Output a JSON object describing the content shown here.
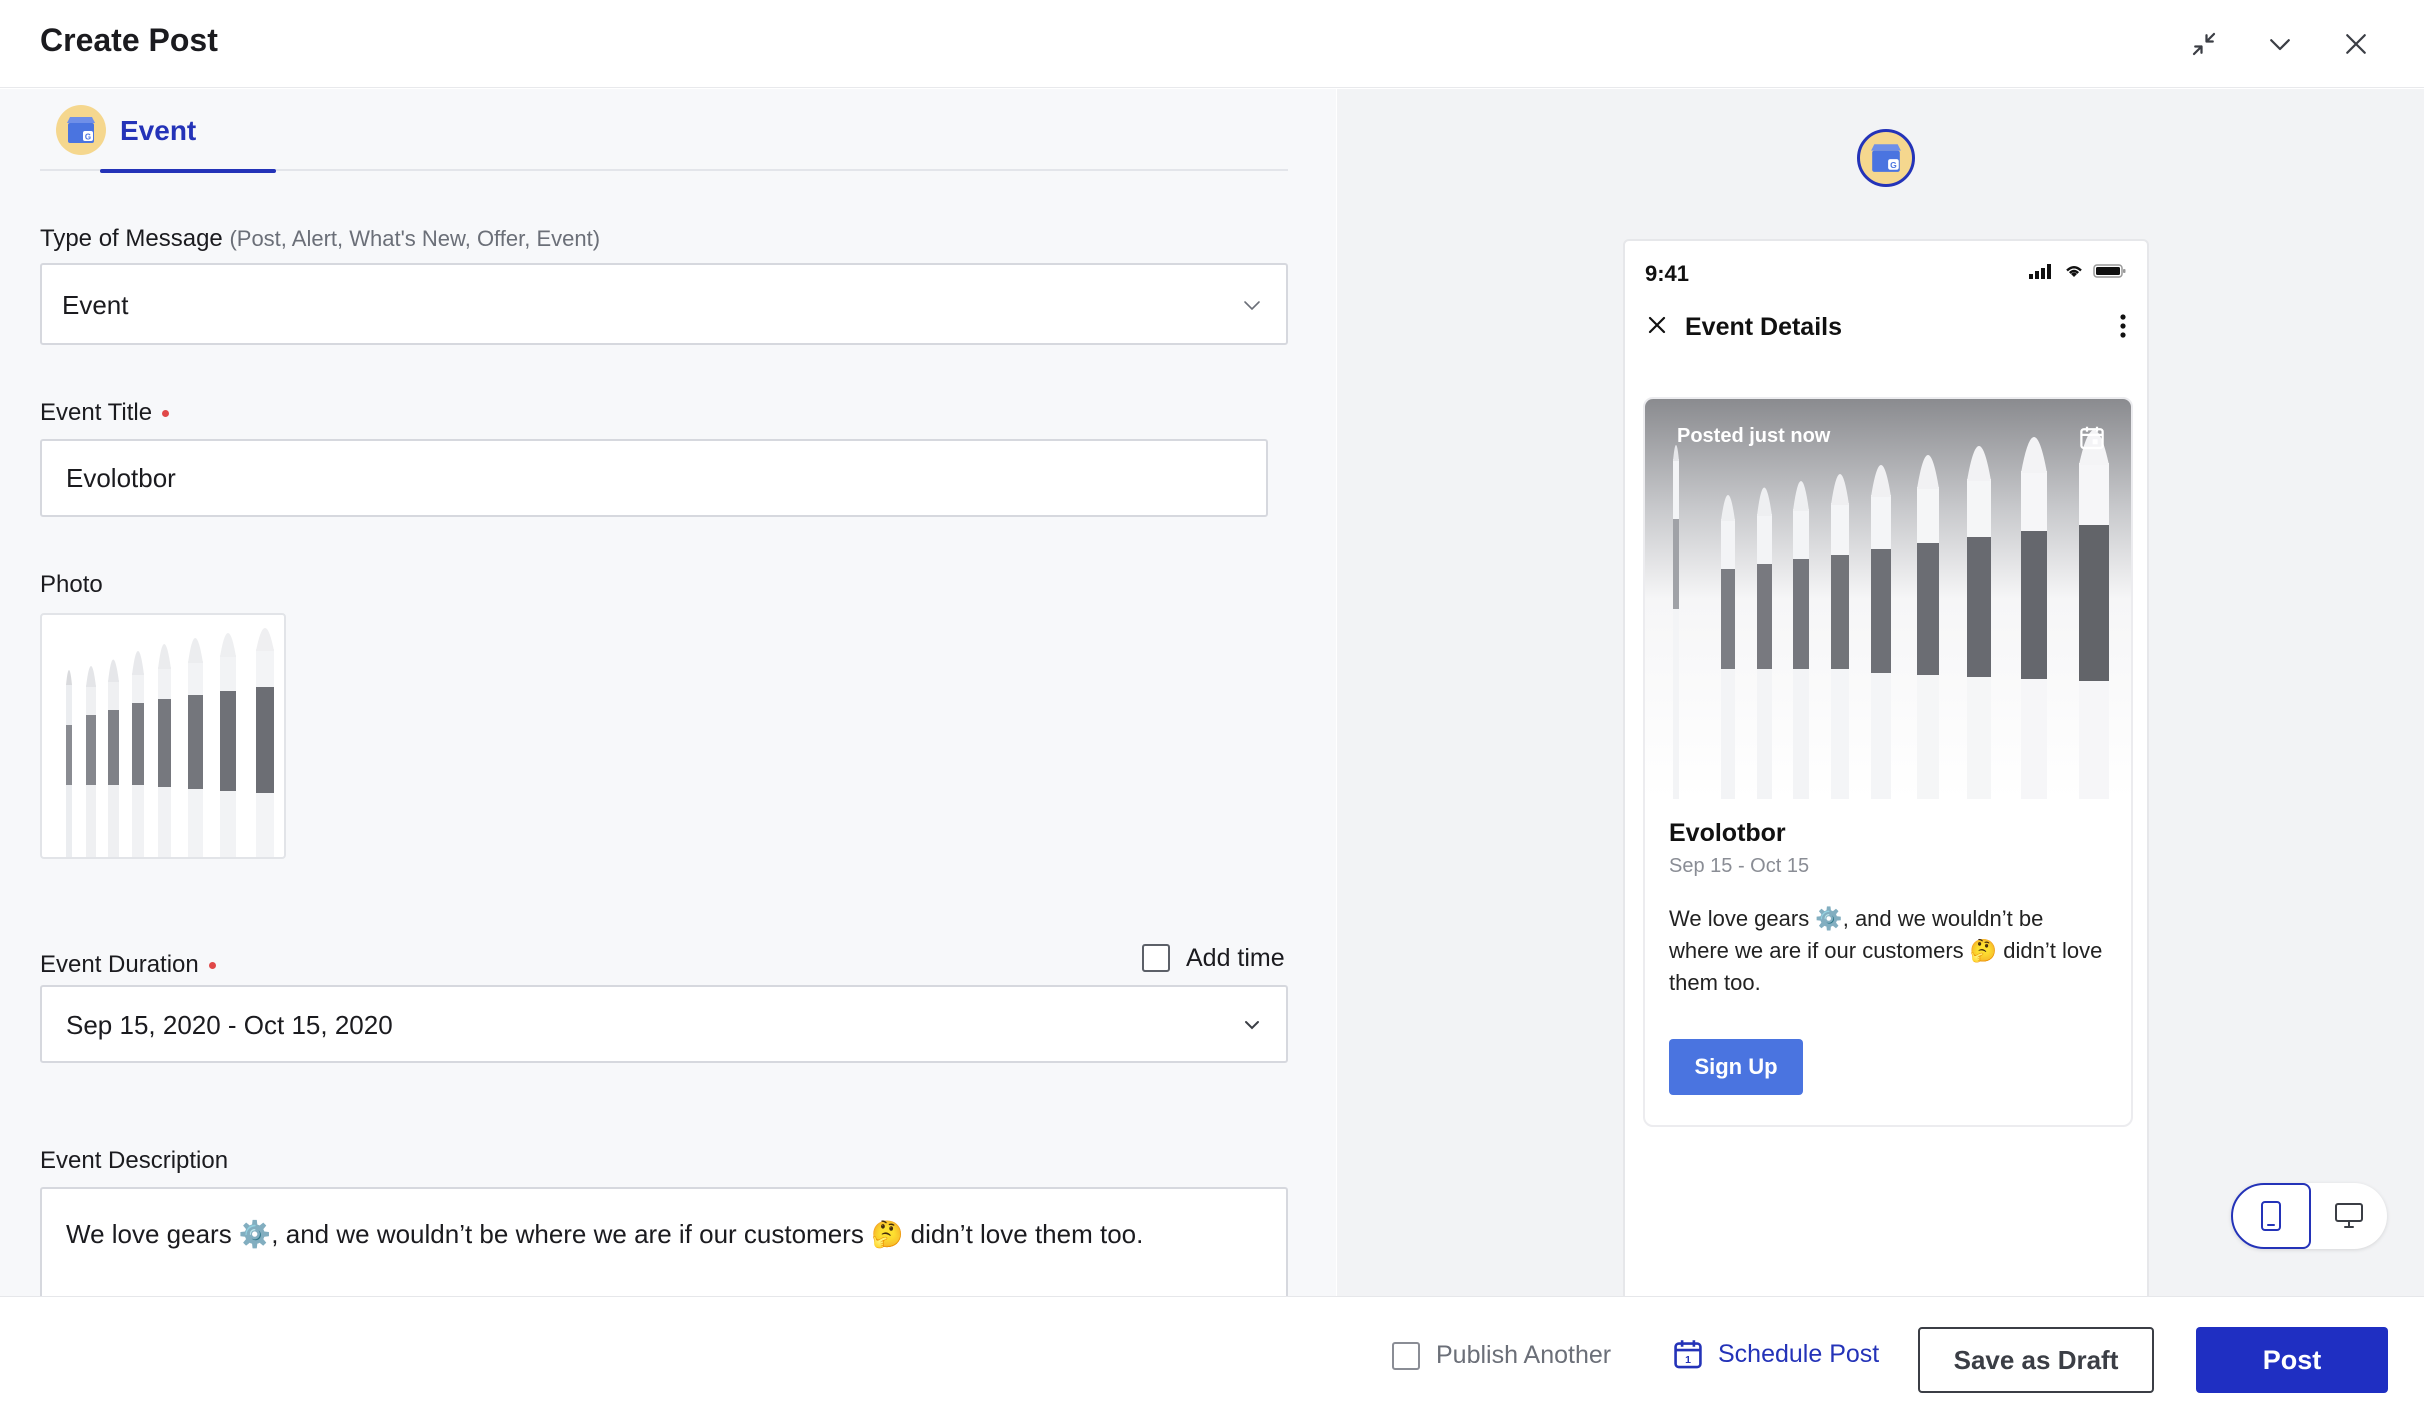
{
  "header": {
    "title": "Create Post",
    "actions": [
      "collapse-icon",
      "chevron-down-icon",
      "close-icon"
    ]
  },
  "tab": {
    "label": "Event",
    "icon": "google-my-business-icon"
  },
  "form": {
    "type_of_message": {
      "label": "Type of Message",
      "hint": "(Post, Alert, What's New, Offer, Event)",
      "value": "Event"
    },
    "event_title": {
      "label": "Event Title",
      "required": true,
      "value": "Evolotbor"
    },
    "photo": {
      "label": "Photo"
    },
    "event_duration": {
      "label": "Event Duration",
      "required": true,
      "value": "Sep 15, 2020 - Oct 15, 2020",
      "add_time_label": "Add time",
      "add_time_checked": false
    },
    "event_description": {
      "label": "Event Description",
      "value": "We love gears ⚙️, and we wouldn’t be where we are if our customers 🤔 didn’t love them too."
    }
  },
  "preview": {
    "status_time": "9:41",
    "nav_title": "Event Details",
    "card": {
      "posted": "Posted just now",
      "title": "Evolotbor",
      "dates": "Sep 15 - Oct 15",
      "description": "We love gears ⚙️, and we wouldn’t be where we are if our customers 🤔 didn’t love them too.",
      "button": "Sign Up"
    },
    "device_toggle": {
      "selected": "mobile",
      "options": [
        "mobile",
        "desktop"
      ]
    }
  },
  "footer": {
    "publish_another": "Publish Another",
    "schedule_post": "Schedule Post",
    "save_draft": "Save as Draft",
    "post": "Post"
  },
  "colors": {
    "accent": "#2433b8",
    "primary_button": "#1f2fc2",
    "signup_button": "#4a74e0",
    "required_dot": "#e04848",
    "avatar_bg": "#f5d78e"
  }
}
